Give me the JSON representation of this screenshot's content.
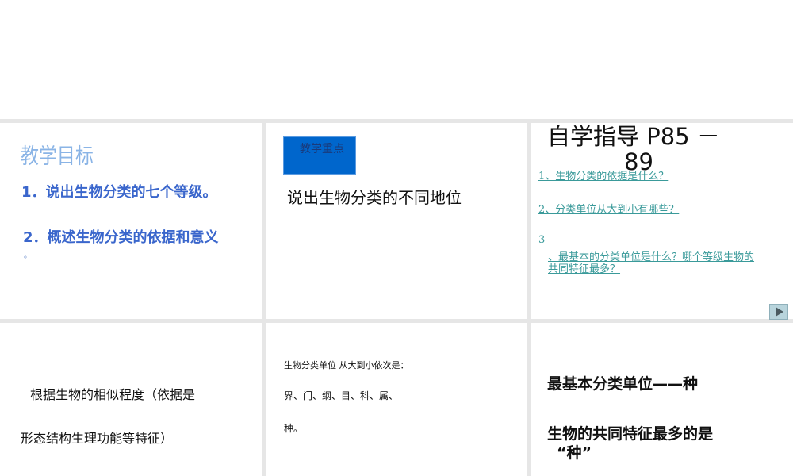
{
  "slide1": {
    "title": "教学目标",
    "items": [
      "1．说出生物分类的七个等级。",
      "2．概述生物分类的依据和意义"
    ],
    "trailing": "。"
  },
  "slide2": {
    "badge": "教学重点",
    "text": "说出生物分类的不同地位"
  },
  "slide3": {
    "title_line1": "自学指导 P85 －",
    "title_line2": "89",
    "questions": [
      "1、生物分类的依据是什么？",
      "2、分类单位从大到小有哪些？"
    ],
    "q3_number": "3",
    "q3_text_line1": "、最基本的分类单位是什么？哪个等级生物的",
    "q3_text_line2": "共同特征最多？",
    "next_icon": "play-triangle-icon"
  },
  "slide4": {
    "line1": "根据生物的相似程度（依据是",
    "line2": "形态结构生理功能等特征）"
  },
  "slide5": {
    "line1": "生物分类单位  从大到小依次是：",
    "line2": "界、门、纲、目、科、属、",
    "line3": "种。"
  },
  "slide6": {
    "line1": "最基本分类单位——种",
    "line2": "生物的共同特征最多的是",
    "line3": "“种”"
  },
  "colors": {
    "accent_blue": "#0066cc",
    "text_blue": "#3a66cc",
    "link_teal": "#3a9a9a"
  }
}
